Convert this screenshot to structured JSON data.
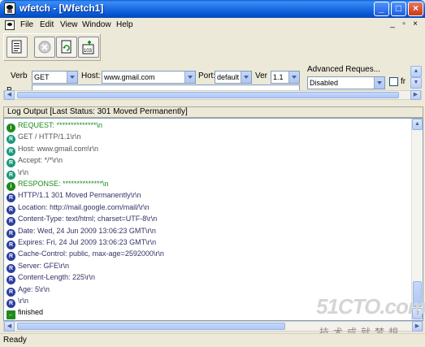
{
  "window": {
    "title": "wfetch - [Wfetch1]",
    "controls": [
      "_",
      "□",
      "×"
    ]
  },
  "menu": {
    "items": [
      "File",
      "Edit",
      "View",
      "Window",
      "Help"
    ],
    "mdi_controls": [
      "_",
      "▫",
      "×"
    ]
  },
  "toolbar": {
    "buttons": [
      "new-request-icon",
      "stop-icon",
      "refresh-icon",
      "open-connection-icon"
    ]
  },
  "request": {
    "verb_label": "Verb",
    "verb_value": "GET",
    "host_label": "Host:",
    "host_value": "www.gmail.com",
    "port_label": "Port:",
    "port_value": "default",
    "ver_label": "Ver",
    "ver_value": "1.1",
    "advanced_label": "Advanced Reques...",
    "advanced_value": "Disabled",
    "checkbox_label": "fr",
    "path_label_partial": "P"
  },
  "log": {
    "header": "Log Output [Last Status: 301 Moved Permanently]",
    "lines": [
      {
        "icon": "i",
        "color": "#1e8a1e",
        "text": "REQUEST: **************\\n",
        "text_color": "#1e8a1e"
      },
      {
        "icon": "R",
        "color": "#1a9a7a",
        "text": "GET / HTTP/1.1\\r\\n",
        "text_color": "#555555"
      },
      {
        "icon": "R",
        "color": "#1a9a7a",
        "text": "Host: www.gmail.com\\r\\n",
        "text_color": "#555555"
      },
      {
        "icon": "R",
        "color": "#1a9a7a",
        "text": "Accept: */*\\r\\n",
        "text_color": "#555555"
      },
      {
        "icon": "R",
        "color": "#1a9a7a",
        "text": "\\r\\n",
        "text_color": "#555555"
      },
      {
        "icon": "i",
        "color": "#1e8a1e",
        "text": "RESPONSE: **************\\n",
        "text_color": "#1e8a1e"
      },
      {
        "icon": "R",
        "color": "#2a3ea0",
        "text": "HTTP/1.1 301 Moved Permanently\\r\\n",
        "text_color": "#333366"
      },
      {
        "icon": "R",
        "color": "#2a3ea0",
        "text": "Location: http://mail.google.com/mail/\\r\\n",
        "text_color": "#333366"
      },
      {
        "icon": "R",
        "color": "#2a3ea0",
        "text": "Content-Type: text/html; charset=UTF-8\\r\\n",
        "text_color": "#333366"
      },
      {
        "icon": "R",
        "color": "#2a3ea0",
        "text": "Date: Wed, 24 Jun 2009 13:06:23 GMT\\r\\n",
        "text_color": "#333366"
      },
      {
        "icon": "R",
        "color": "#2a3ea0",
        "text": "Expires: Fri, 24 Jul 2009 13:06:23 GMT\\r\\n",
        "text_color": "#333366"
      },
      {
        "icon": "R",
        "color": "#2a3ea0",
        "text": "Cache-Control: public, max-age=2592000\\r\\n",
        "text_color": "#333366"
      },
      {
        "icon": "R",
        "color": "#2a3ea0",
        "text": "Server: GFE\\r\\n",
        "text_color": "#333366"
      },
      {
        "icon": "R",
        "color": "#2a3ea0",
        "text": "Content-Length: 225\\r\\n",
        "text_color": "#333366"
      },
      {
        "icon": "R",
        "color": "#2a3ea0",
        "text": "Age: 5\\r\\n",
        "text_color": "#333366"
      },
      {
        "icon": "R",
        "color": "#2a3ea0",
        "text": "\\r\\n",
        "text_color": "#333366"
      },
      {
        "icon": "←",
        "color": "#1e8a1e",
        "text": "finished",
        "text_color": "#000000"
      }
    ]
  },
  "status": {
    "text": "Ready"
  },
  "watermark": {
    "main": "51CTO.com",
    "sub": "技术成就梦想"
  }
}
